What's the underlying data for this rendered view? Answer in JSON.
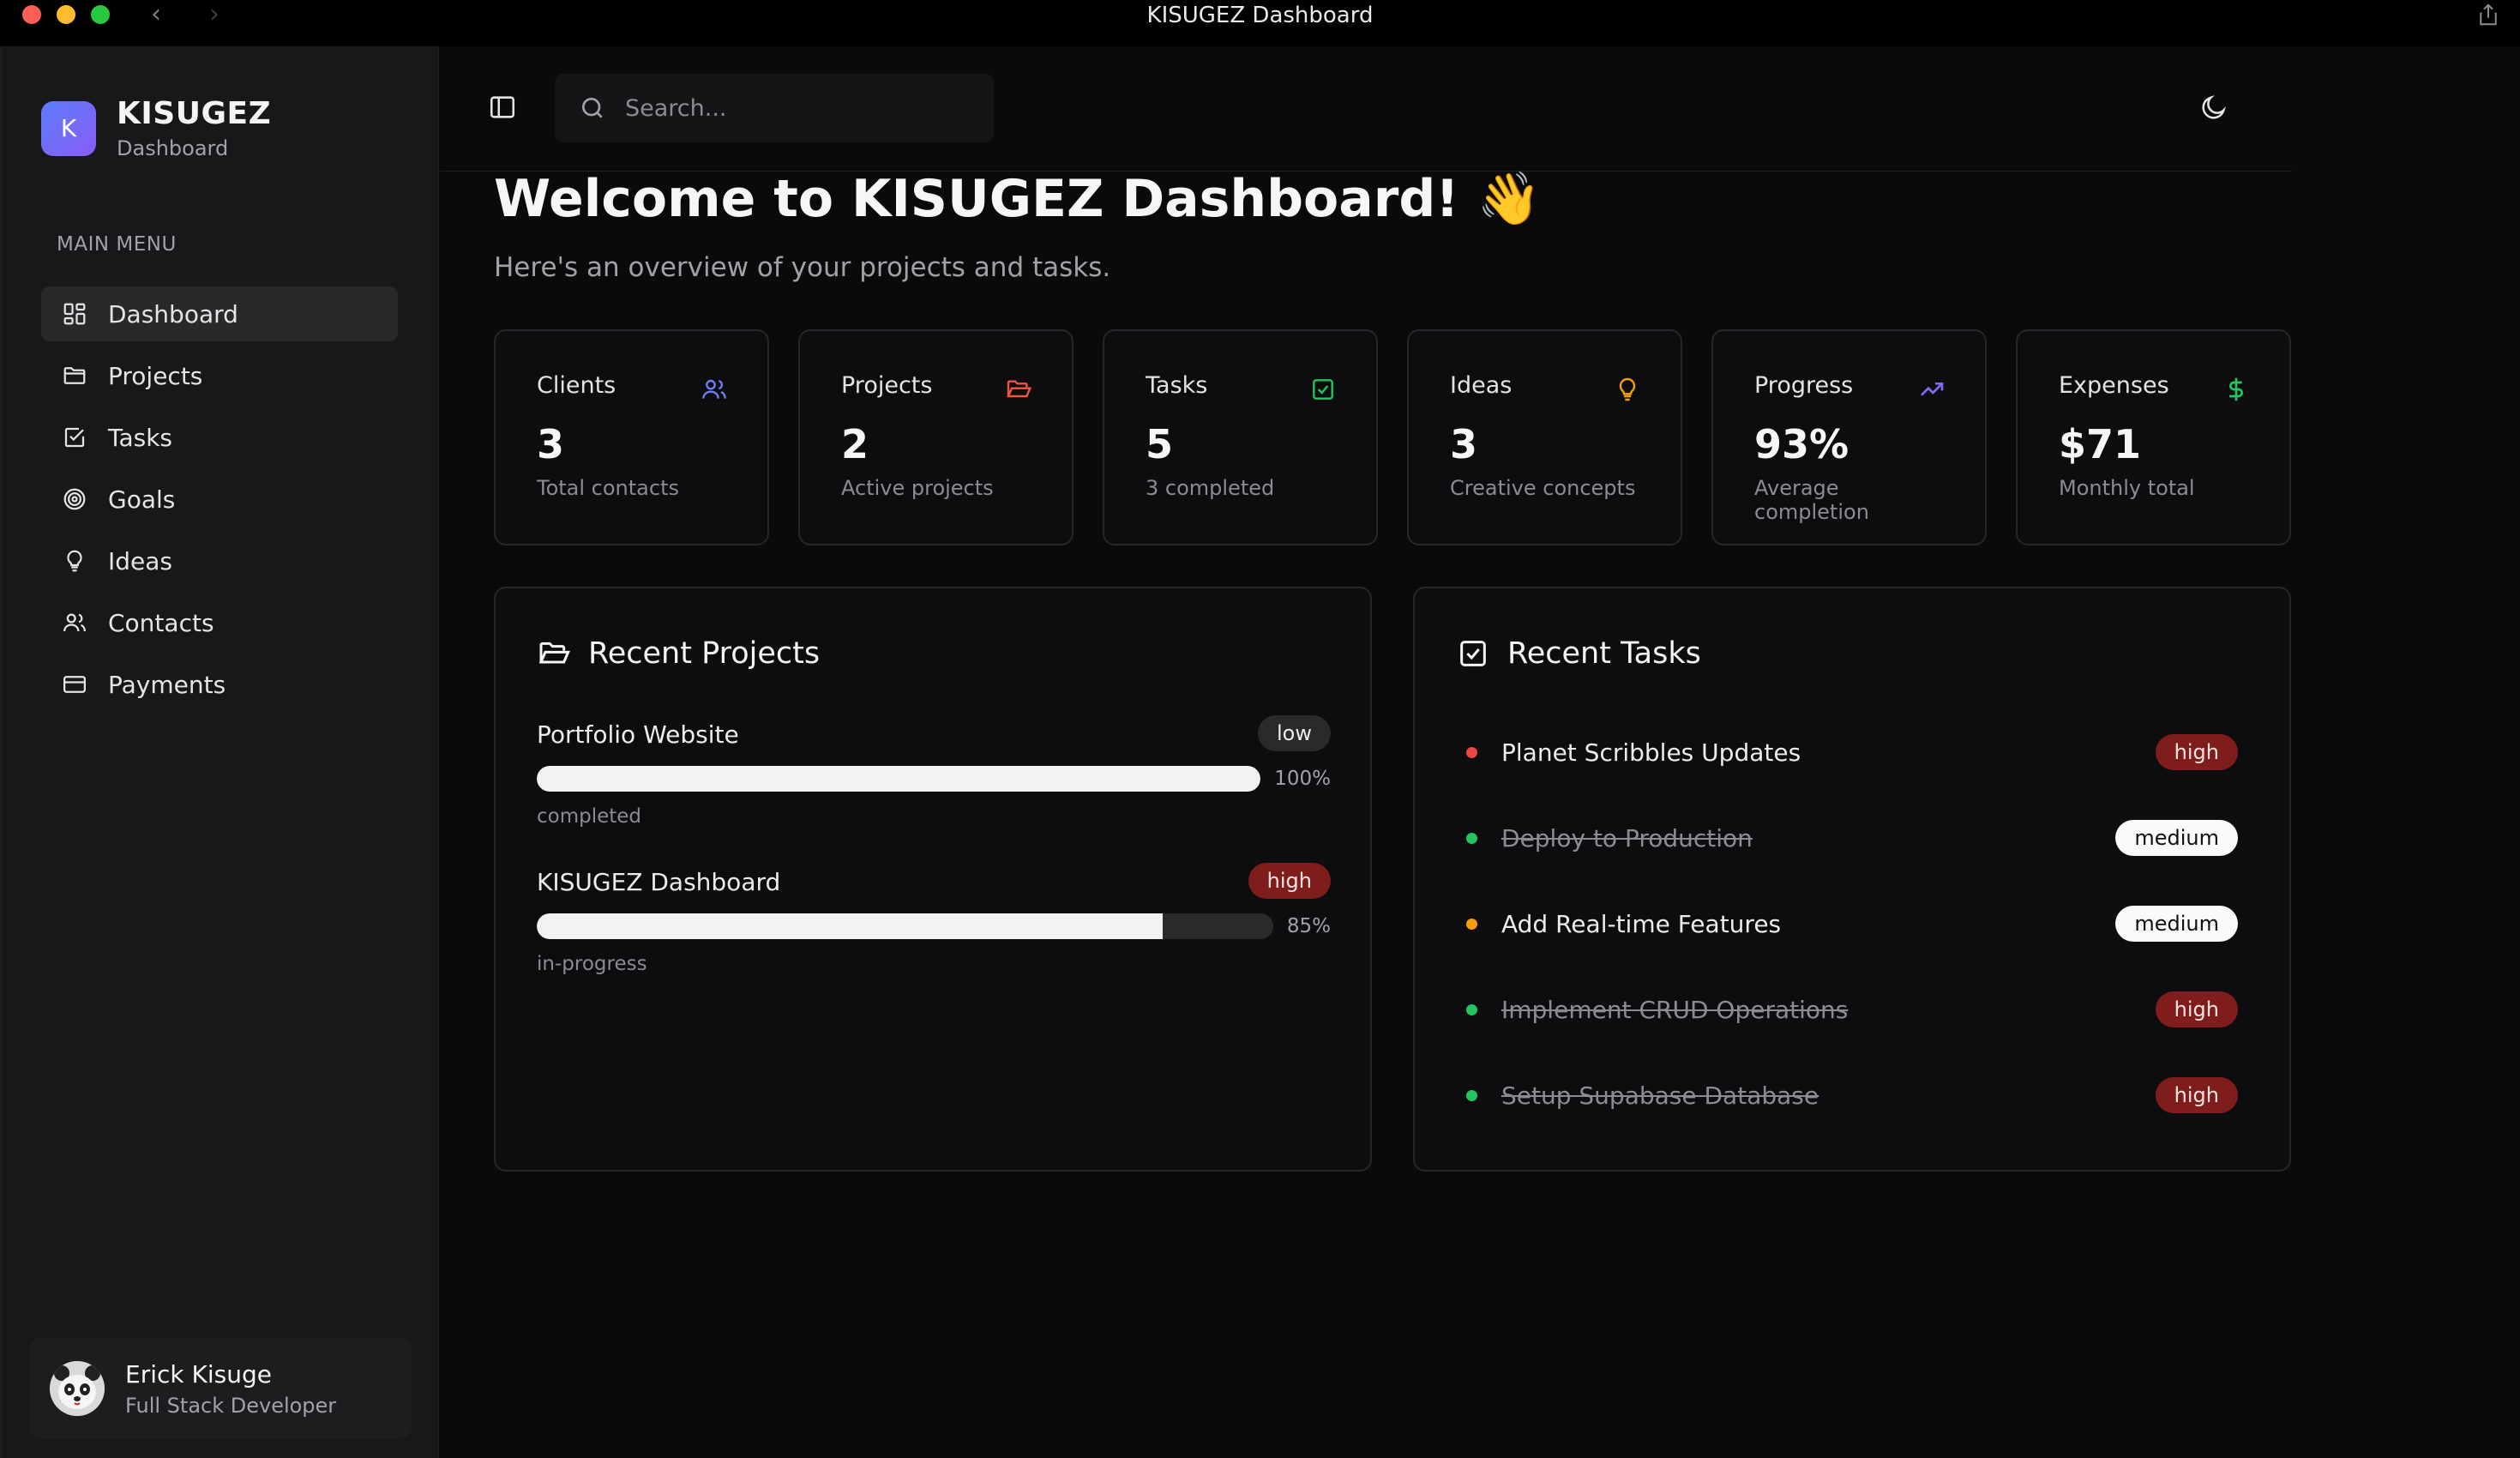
{
  "window": {
    "title": "KISUGEZ Dashboard"
  },
  "brand": {
    "logo_letter": "K",
    "name": "KISUGEZ",
    "subtitle": "Dashboard"
  },
  "sidebar": {
    "heading": "MAIN MENU",
    "items": [
      {
        "label": "Dashboard",
        "icon": "grid-icon",
        "active": true
      },
      {
        "label": "Projects",
        "icon": "folder-icon"
      },
      {
        "label": "Tasks",
        "icon": "checkbox-icon"
      },
      {
        "label": "Goals",
        "icon": "target-icon"
      },
      {
        "label": "Ideas",
        "icon": "lightbulb-icon"
      },
      {
        "label": "Contacts",
        "icon": "users-icon"
      },
      {
        "label": "Payments",
        "icon": "credit-card-icon"
      }
    ]
  },
  "user": {
    "name": "Erick Kisuge",
    "role": "Full Stack Developer"
  },
  "search": {
    "placeholder": "Search..."
  },
  "main": {
    "welcome": "Welcome to KISUGEZ Dashboard! 👋",
    "subtitle": "Here's an overview of your projects and tasks."
  },
  "stats": [
    {
      "title": "Clients",
      "value": "3",
      "desc": "Total contacts",
      "icon": "users-icon",
      "color": "#6d7ff5"
    },
    {
      "title": "Projects",
      "value": "2",
      "desc": "Active projects",
      "icon": "folder-open-icon",
      "color": "#f0573f"
    },
    {
      "title": "Tasks",
      "value": "5",
      "desc": "3 completed",
      "icon": "checkbox-icon",
      "color": "#22c55e"
    },
    {
      "title": "Ideas",
      "value": "3",
      "desc": "Creative concepts",
      "icon": "lightbulb-icon",
      "color": "#f59e0b"
    },
    {
      "title": "Progress",
      "value": "93%",
      "desc": "Average completion",
      "icon": "trending-up-icon",
      "color": "#7c6cf5"
    },
    {
      "title": "Expenses",
      "value": "$71",
      "desc": "Monthly total",
      "icon": "dollar-icon",
      "color": "#22c55e"
    }
  ],
  "recent_projects": {
    "title": "Recent Projects",
    "items": [
      {
        "name": "Portfolio Website",
        "priority": "low",
        "progress": 100,
        "progress_label": "100%",
        "status": "completed"
      },
      {
        "name": "KISUGEZ Dashboard",
        "priority": "high",
        "progress": 85,
        "progress_label": "85%",
        "status": "in-progress"
      }
    ]
  },
  "recent_tasks": {
    "title": "Recent Tasks",
    "items": [
      {
        "label": "Planet Scribbles Updates",
        "priority": "high",
        "done": false,
        "dot_color": "#ef4444"
      },
      {
        "label": "Deploy to Production",
        "priority": "medium",
        "done": true,
        "dot_color": "#22c55e"
      },
      {
        "label": "Add Real-time Features",
        "priority": "medium",
        "done": false,
        "dot_color": "#f59e0b"
      },
      {
        "label": "Implement CRUD Operations",
        "priority": "high",
        "done": true,
        "dot_color": "#22c55e"
      },
      {
        "label": "Setup Supabase Database",
        "priority": "high",
        "done": true,
        "dot_color": "#22c55e"
      }
    ]
  }
}
